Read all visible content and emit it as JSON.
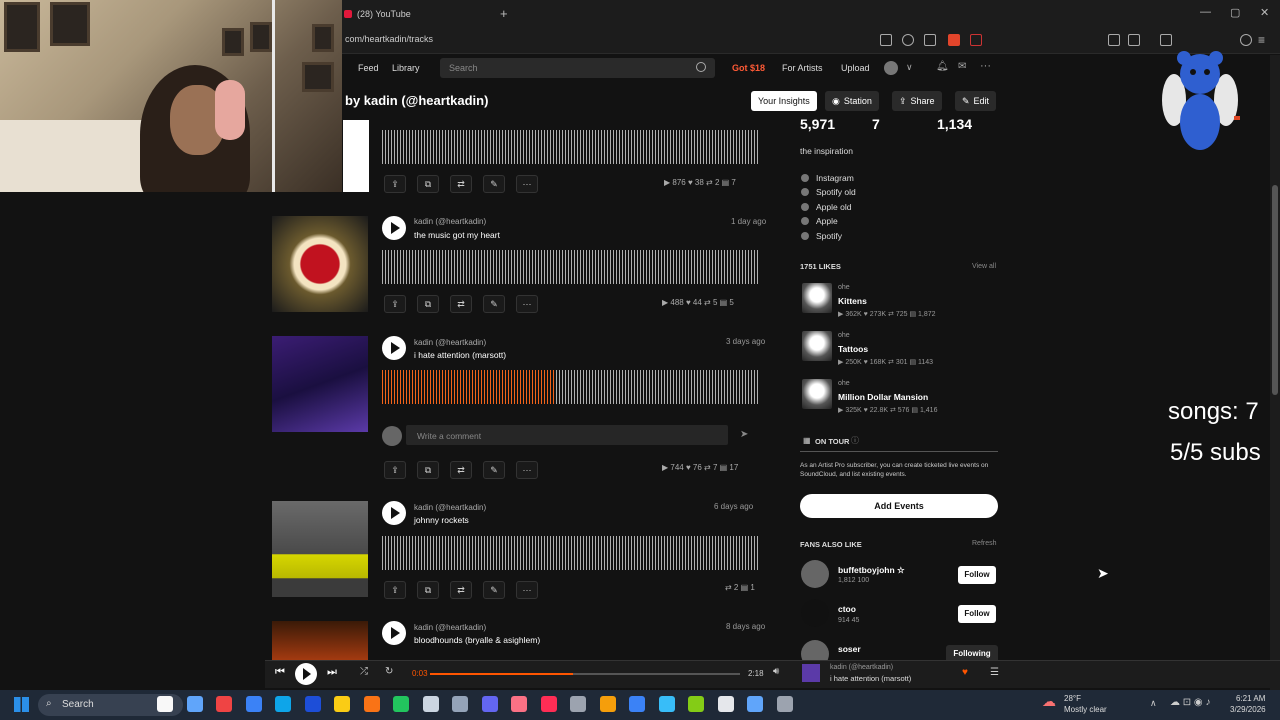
{
  "browser": {
    "tab_title": "(28) YouTube",
    "url": "com/heartkadin/tracks"
  },
  "header": {
    "nav": [
      "Feed",
      "Library"
    ],
    "search_placeholder": "Search",
    "gold_label": "Got $18",
    "for_artists": "For Artists",
    "upload": "Upload"
  },
  "page": {
    "title": "by kadin (@heartkadin)",
    "buttons": {
      "insights": "Your Insights",
      "station": "Station",
      "share": "Share",
      "edit": "Edit"
    }
  },
  "tracks": [
    {
      "user": "",
      "title": "",
      "date": "",
      "stats": "▶ 876  ♥ 38  ⇄ 2  ▤ 7",
      "played_fraction": 0,
      "art": "black-white"
    },
    {
      "user": "kadin (@heartkadin)",
      "title": "the music got my heart",
      "date": "1 day ago",
      "stats": "▶ 488  ♥ 44  ⇄ 5  ▤ 5",
      "played_fraction": 0,
      "art": "music-heart"
    },
    {
      "user": "kadin (@heartkadin)",
      "title": "i hate attention (marsott)",
      "date": "3 days ago",
      "stats": "▶ 744  ♥ 76  ⇄ 7  ▤ 17",
      "played_fraction": 0.46,
      "art": "purple-room",
      "comment_placeholder": "Write a comment"
    },
    {
      "user": "kadin (@heartkadin)",
      "title": "johnny rockets",
      "date": "6 days ago",
      "stats": "⇄ 2  ▤ 1",
      "played_fraction": 0,
      "art": "yellow-pants"
    },
    {
      "user": "kadin (@heartkadin)",
      "title": "bloodhounds (bryalle & asighlem)",
      "date": "8 days ago",
      "stats": "",
      "played_fraction": 0,
      "art": "fire"
    }
  ],
  "sidebar": {
    "stats": [
      "5,971",
      "7",
      "1,134"
    ],
    "bio": "the inspiration",
    "links": [
      "Instagram",
      "Spotify old",
      "Apple old",
      "Apple",
      "Spotify"
    ],
    "likes_heading": "1751 LIKES",
    "view_all": "View all",
    "likes": [
      {
        "user": "ohe",
        "title": "Kittens",
        "stats": "▶ 362K  ♥ 273K  ⇄ 725  ▤ 1,872"
      },
      {
        "user": "ohe",
        "title": "Tattoos",
        "stats": "▶ 250K  ♥ 168K  ⇄ 301  ▤ 1143"
      },
      {
        "user": "ohe",
        "title": "Million Dollar Mansion",
        "stats": "▶ 325K  ♥ 22.8K  ⇄ 576  ▤ 1,416"
      }
    ],
    "on_tour": "ON TOUR",
    "tour_text": "As an Artist Pro subscriber, you can create ticketed live events on SoundCloud, and list existing events.",
    "add_events": "Add Events",
    "fans_heading": "FANS ALSO LIKE",
    "refresh": "Refresh",
    "fans": [
      {
        "name": "buffetboyjohn ☆",
        "stats": "1,812  100",
        "button": "Follow"
      },
      {
        "name": "ctoo",
        "stats": "914  45",
        "button": "Follow"
      },
      {
        "name": "soser",
        "stats": "",
        "button": "Following"
      }
    ]
  },
  "overlay": {
    "songs": "songs: 7",
    "subs": "5/5 subs"
  },
  "player": {
    "elapsed": "0:03",
    "duration": "2:18",
    "progress": 0.46,
    "now_user": "kadin (@heartkadin)",
    "now_title": "i hate attention (marsott)"
  },
  "taskbar": {
    "search": "Search",
    "weather_temp": "28°F",
    "weather_desc": "Mostly clear",
    "time": "6:21 AM",
    "date": "3/29/2026"
  }
}
